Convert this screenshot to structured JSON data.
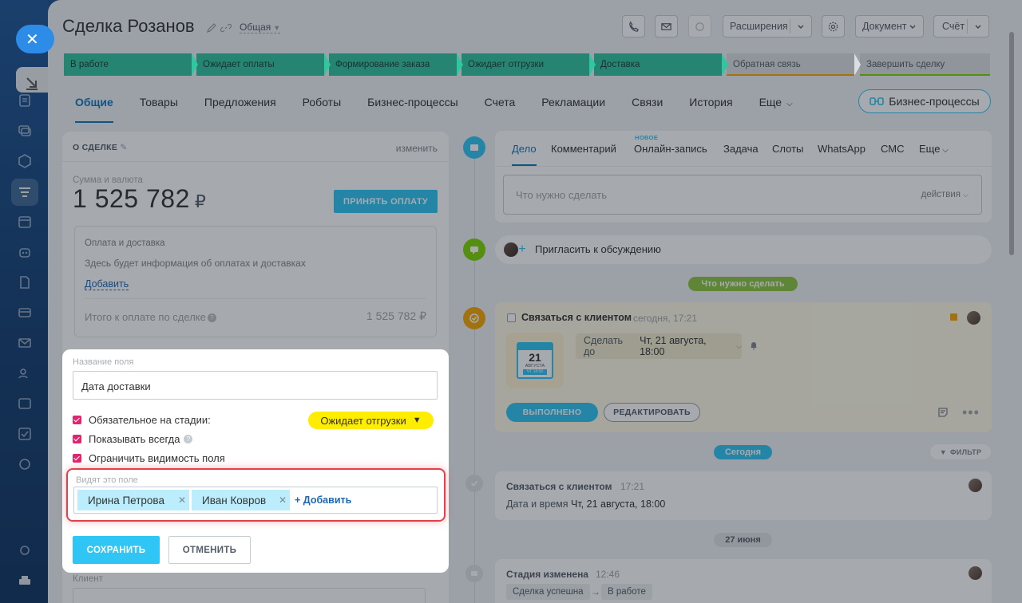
{
  "deal": {
    "title": "Сделка Розанов",
    "category": "Общая"
  },
  "header_buttons": {
    "extensions": "Расширения",
    "document": "Документ",
    "invoice": "Счёт"
  },
  "stages": [
    {
      "label": "В работе",
      "state": "done",
      "color": "#2fc6a0"
    },
    {
      "label": "Ожидает оплаты",
      "state": "done",
      "color": "#2fc6a0"
    },
    {
      "label": "Формирование заказа",
      "state": "done",
      "color": "#2fc6a0"
    },
    {
      "label": "Ожидает отгрузки",
      "state": "done",
      "color": "#2fc6a0"
    },
    {
      "label": "Доставка",
      "state": "done",
      "color": "#2fc6a0"
    },
    {
      "label": "Обратная связь",
      "state": "todo",
      "color": "#f7a700"
    },
    {
      "label": "Завершить сделку",
      "state": "todo",
      "color": "#7bd500"
    }
  ],
  "tabs": [
    "Общие",
    "Товары",
    "Предложения",
    "Роботы",
    "Бизнес-процессы",
    "Счета",
    "Рекламации",
    "Связи",
    "История",
    "Еще"
  ],
  "bp_button": "Бизнес-процессы",
  "about": {
    "heading": "О СДЕЛКЕ",
    "edit": "изменить",
    "amount_label": "Сумма и валюта",
    "amount": "1 525 782",
    "currency": "₽",
    "accept_payment": "ПРИНЯТЬ ОПЛАТУ",
    "payment_title": "Оплата и доставка",
    "payment_info": "Здесь будет информация об оплатах и доставках",
    "payment_add": "Добавить",
    "total_label": "Итого к оплате по сделке",
    "total_value": "1 525 782 ₽",
    "client_label": "Клиент"
  },
  "composer": {
    "tabs": [
      "Дело",
      "Комментарий",
      "Онлайн-запись",
      "Задача",
      "Слоты",
      "WhatsApp",
      "СМС",
      "Еще"
    ],
    "new_badge": "НОВОЕ",
    "placeholder": "Что нужно сделать",
    "actions": "действия"
  },
  "invite": "Пригласить к обсуждению",
  "todo_pill": "Что нужно сделать",
  "task": {
    "title": "Связаться с клиентом",
    "time": "сегодня, 17:21",
    "deadline_prefix": "Сделать до",
    "deadline": "Чт, 21 августа, 18:00",
    "cal_day": "21",
    "cal_month": "АВГУСТА",
    "cal_week": "ЧТ 18:00",
    "done": "ВЫПОЛНЕНО",
    "edit": "РЕДАКТИРОВАТЬ"
  },
  "today_pill": "Сегодня",
  "filter": "ФИЛЬТР",
  "history": [
    {
      "title": "Связаться с клиентом",
      "time": "17:21",
      "sub_prefix": "Дата и время",
      "sub_value": "Чт, 21 августа, 18:00"
    },
    {
      "title": "Стадия изменена",
      "time": "12:46",
      "from": "Сделка успешна",
      "to": "В работе"
    }
  ],
  "date_pill": "27 июня",
  "popup": {
    "field_name_label": "Название поля",
    "field_name_value": "Дата доставки",
    "required_label": "Обязательное на стадии:",
    "required_stage": "Ожидает отгрузки",
    "always_show": "Показывать всегда",
    "limit_visibility": "Ограничить видимость поля",
    "who_sees": "Видят это поле",
    "users": [
      "Ирина Петрова",
      "Иван Ковров"
    ],
    "add_user": "+ Добавить",
    "save": "СОХРАНИТЬ",
    "cancel": "ОТМЕНИТЬ",
    "stage_color": "#ffed00",
    "highlight_color": "#e2404c"
  }
}
